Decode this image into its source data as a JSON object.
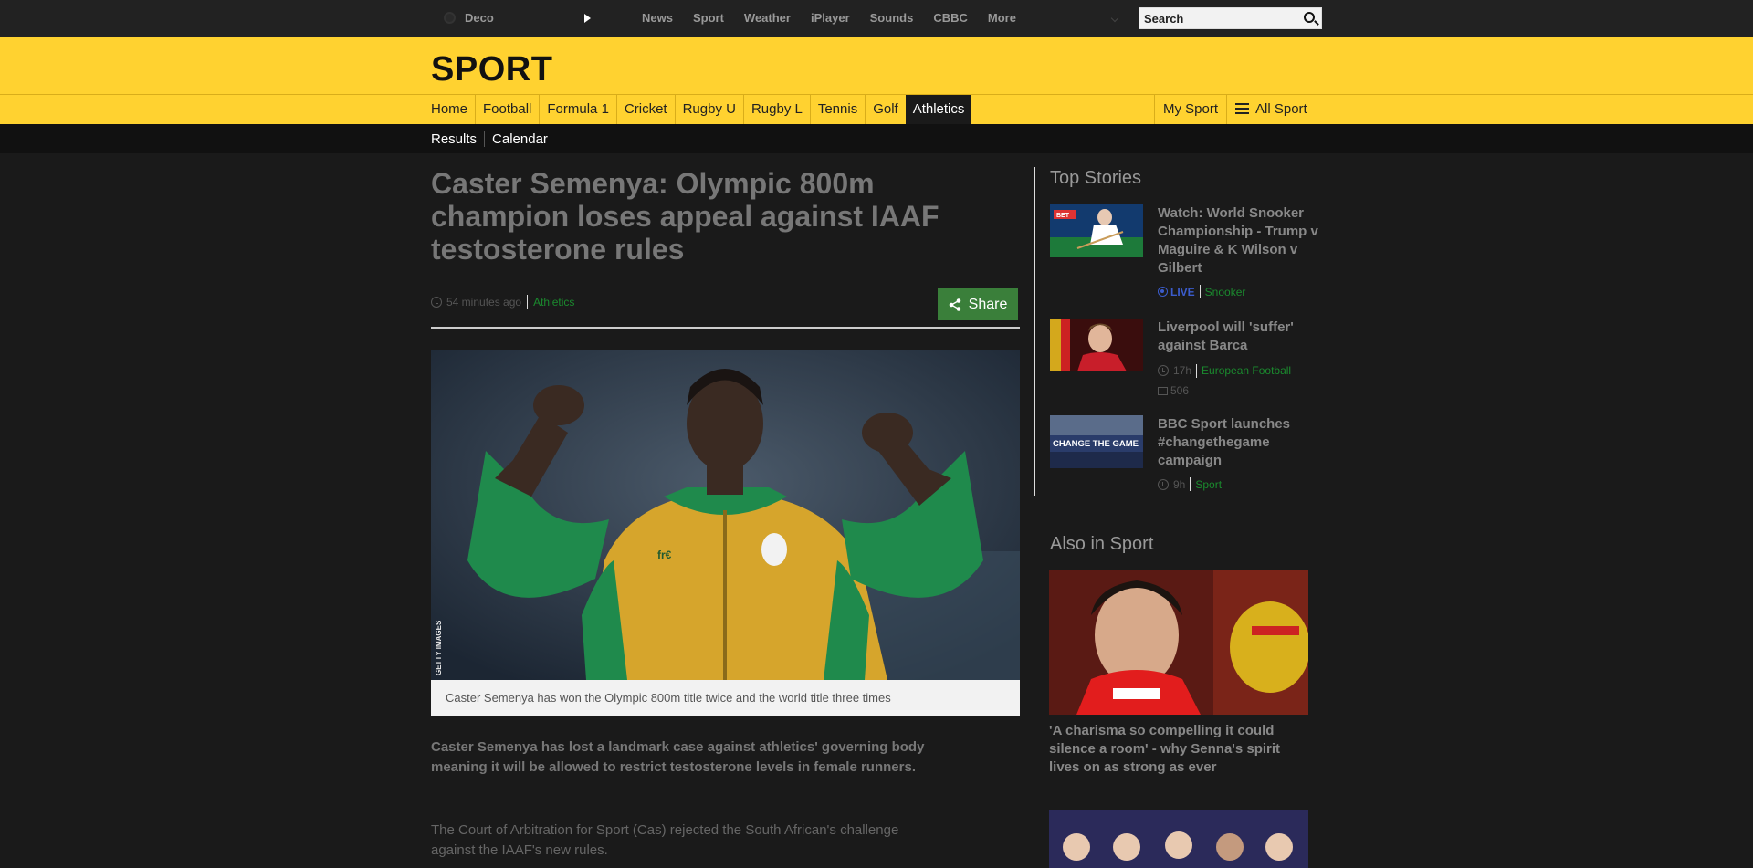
{
  "topbar": {
    "account_label": "Deco",
    "nav": [
      "News",
      "Sport",
      "Weather",
      "iPlayer",
      "Sounds",
      "CBBC",
      "More"
    ],
    "search_placeholder": "Search"
  },
  "brand": {
    "title": "SPORT"
  },
  "sport_nav": {
    "items": [
      "Home",
      "Football",
      "Formula 1",
      "Cricket",
      "Rugby U",
      "Rugby L",
      "Tennis",
      "Golf",
      "Athletics"
    ],
    "active": "Athletics",
    "my_sport": "My Sport",
    "all_sport": "All Sport"
  },
  "sub_nav": {
    "items": [
      "Results",
      "Calendar"
    ]
  },
  "article": {
    "headline": "Caster Semenya: Olympic 800m champion loses appeal against IAAF testosterone rules",
    "timestamp": "54 minutes ago",
    "section_tag": "Athletics",
    "share_label": "Share",
    "image_credit": "GETTY IMAGES",
    "caption": "Caster Semenya has won the Olympic 800m title twice and the world title three times",
    "lead": "Caster Semenya has lost a landmark case against athletics' governing body meaning it will be allowed to restrict testosterone levels in female runners.",
    "paragraph": "The Court of Arbitration for Sport (Cas) rejected the South African's challenge against the IAAF's new rules."
  },
  "sidebar": {
    "top_stories_heading": "Top Stories",
    "stories": [
      {
        "title": "Watch: World Snooker Championship - Trump v Maguire & K Wilson v Gilbert",
        "live_label": "LIVE",
        "tag": "Snooker"
      },
      {
        "title": "Liverpool will 'suffer' against Barca",
        "time": "17h",
        "tag": "European Football",
        "comments": "506"
      },
      {
        "title": "BBC Sport launches #changethegame campaign",
        "time": "9h",
        "tag": "Sport",
        "thumb_text": "CHANGE THE GAME"
      }
    ],
    "also_heading": "Also in Sport",
    "also_story_title": "'A charisma so compelling it could silence a room' - why Senna's spirit lives on as strong as ever"
  },
  "colors": {
    "brand_yellow": "#ffd230",
    "tag_green": "#1a8a2e",
    "share_green": "#3a7f3a",
    "live_blue": "#3b5ccc"
  }
}
